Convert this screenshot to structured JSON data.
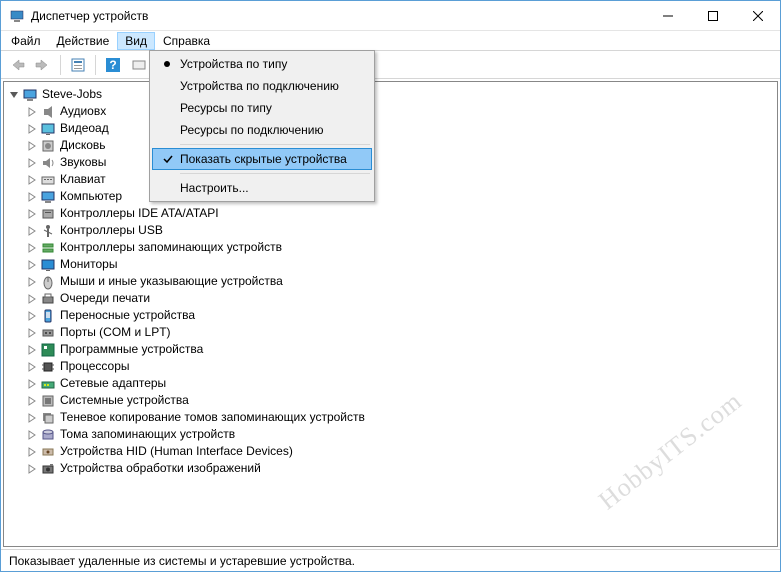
{
  "window": {
    "title": "Диспетчер устройств"
  },
  "menubar": {
    "items": [
      {
        "label": "Файл"
      },
      {
        "label": "Действие"
      },
      {
        "label": "Вид",
        "open": true
      },
      {
        "label": "Справка"
      }
    ]
  },
  "dropdown": {
    "items": [
      {
        "label": "Устройства по типу",
        "marker": "radio"
      },
      {
        "label": "Устройства по подключению"
      },
      {
        "label": "Ресурсы по типу"
      },
      {
        "label": "Ресурсы по подключению"
      },
      {
        "sep": true
      },
      {
        "label": "Показать скрытые устройства",
        "marker": "check",
        "highlighted": true
      },
      {
        "sep": true
      },
      {
        "label": "Настроить..."
      }
    ]
  },
  "tree": {
    "root": {
      "label": "Steve-Jobs",
      "icon": "computer"
    },
    "children": [
      {
        "label": "Аудиовх",
        "icon": "audio"
      },
      {
        "label": "Видеоад",
        "icon": "display"
      },
      {
        "label": "Дисковь",
        "icon": "disk"
      },
      {
        "label": "Звуковы",
        "icon": "sound"
      },
      {
        "label": "Клавиат",
        "icon": "keyboard"
      },
      {
        "label": "Компьютер",
        "icon": "computer"
      },
      {
        "label": "Контроллеры IDE ATA/ATAPI",
        "icon": "ide"
      },
      {
        "label": "Контроллеры USB",
        "icon": "usb"
      },
      {
        "label": "Контроллеры запоминающих устройств",
        "icon": "storage"
      },
      {
        "label": "Мониторы",
        "icon": "monitor"
      },
      {
        "label": "Мыши и иные указывающие устройства",
        "icon": "mouse"
      },
      {
        "label": "Очереди печати",
        "icon": "printer"
      },
      {
        "label": "Переносные устройства",
        "icon": "portable"
      },
      {
        "label": "Порты (COM и LPT)",
        "icon": "port"
      },
      {
        "label": "Программные устройства",
        "icon": "software"
      },
      {
        "label": "Процессоры",
        "icon": "cpu"
      },
      {
        "label": "Сетевые адаптеры",
        "icon": "network"
      },
      {
        "label": "Системные устройства",
        "icon": "system"
      },
      {
        "label": "Теневое копирование томов запоминающих устройств",
        "icon": "shadow"
      },
      {
        "label": "Тома запоминающих устройств",
        "icon": "volume"
      },
      {
        "label": "Устройства HID (Human Interface Devices)",
        "icon": "hid"
      },
      {
        "label": "Устройства обработки изображений",
        "icon": "imaging"
      }
    ]
  },
  "statusbar": {
    "text": "Показывает удаленные из системы и устаревшие устройства."
  },
  "watermark": "HobbyITS.com"
}
